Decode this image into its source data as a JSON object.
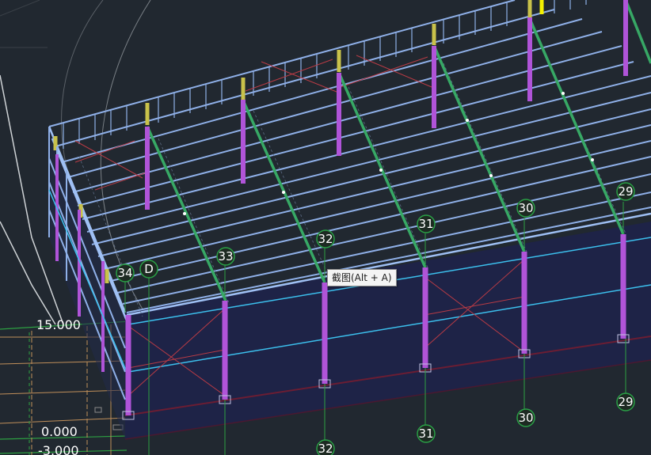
{
  "colors": {
    "background": "#212830",
    "wall_panel": "#1e2347",
    "frame": "#8fb0e8",
    "column": "#b054d8",
    "rafter": "#37a865",
    "gutter": "#c9c24a",
    "bracing": "#b83b45",
    "girt": "#3cc0ee",
    "grid_line": "#2da042",
    "bubble_border": "#2aa046",
    "baseline": "#6b1d33"
  },
  "grid_bubbles": [
    {
      "id": "34",
      "label": "34"
    },
    {
      "id": "D",
      "label": "D"
    },
    {
      "id": "33-top",
      "label": "33"
    },
    {
      "id": "32-top",
      "label": "32"
    },
    {
      "id": "31-top",
      "label": "31"
    },
    {
      "id": "30-top",
      "label": "30"
    },
    {
      "id": "29-top",
      "label": "29"
    },
    {
      "id": "30-bottom",
      "label": "30"
    },
    {
      "id": "29-bottom",
      "label": "29"
    },
    {
      "id": "31-bottom",
      "label": "31"
    },
    {
      "id": "32-bottom",
      "label": "32"
    }
  ],
  "levels": [
    {
      "id": "level-15",
      "label": "15.000"
    },
    {
      "id": "level-0",
      "label": "0.000"
    },
    {
      "id": "level-neg3",
      "label": "-3.000"
    }
  ],
  "tooltip": {
    "text": "截图(Alt + A)"
  }
}
